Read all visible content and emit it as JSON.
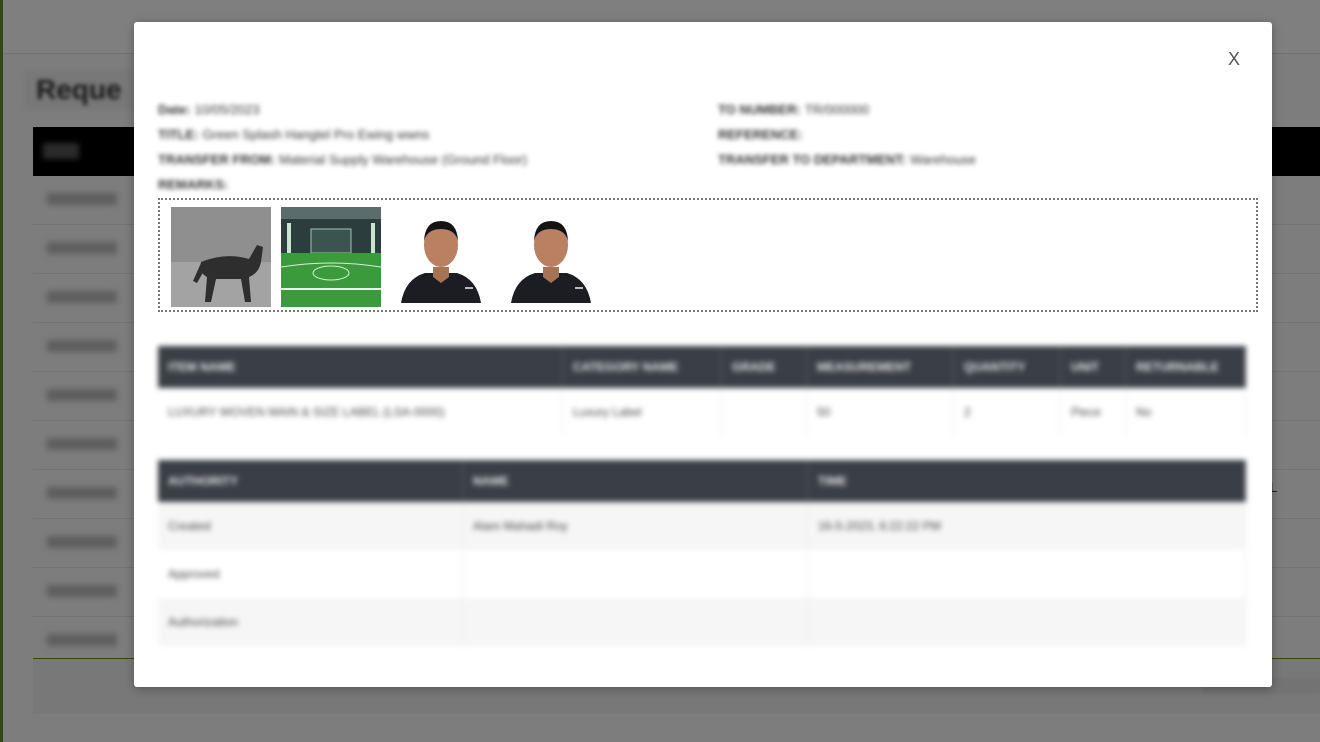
{
  "background": {
    "page_heading": "Reque",
    "table_rows": 10,
    "edge_char": "L"
  },
  "modal": {
    "close_label": "X",
    "info_left": [
      {
        "label": "Date:",
        "value": "10/05/2023"
      },
      {
        "label": "TITLE:",
        "value": "Green Splash Hangtel Pro Ewing wwns"
      },
      {
        "label": "TRANSFER FROM:",
        "value": "Material Supply Warehouse (Ground Floor)"
      },
      {
        "label": "REMARKS:",
        "value": ""
      }
    ],
    "info_right": [
      {
        "label": "TO NUMBER:",
        "value": "TR/000000"
      },
      {
        "label": "REFERENCE:",
        "value": ""
      },
      {
        "label": "TRANSFER TO DEPARTMENT:",
        "value": "Warehouse"
      }
    ],
    "attachments": [
      {
        "name": "dog-photo",
        "icon": "dog-photo"
      },
      {
        "name": "field-photo",
        "icon": "football-field-photo"
      },
      {
        "name": "portrait-photo-1",
        "icon": "person-portrait"
      },
      {
        "name": "portrait-photo-2",
        "icon": "person-portrait"
      }
    ],
    "items_table": {
      "headers": [
        "ITEM NAME",
        "CATEGORY NAME",
        "GRADE",
        "MEASUREMENT",
        "QUANTITY",
        "UNIT",
        "RETURNABLE"
      ],
      "rows": [
        [
          "LUXURY WOVEN MAIN & SIZE LABEL (LSA-0000)",
          "Luxury Label",
          "",
          "50",
          "2",
          "Piece",
          "No"
        ]
      ]
    },
    "authority_table": {
      "headers": [
        "AUTHORITY",
        "NAME",
        "TIME"
      ],
      "rows": [
        [
          "Created",
          "Alam Mahadi Roy",
          "16-5-2023, 6:22:22 PM"
        ],
        [
          "Approved",
          "",
          ""
        ],
        [
          "Authorization",
          "",
          ""
        ]
      ]
    }
  },
  "colors": {
    "overlay": "#000000",
    "table_header": "#3a3f47",
    "accent": "#6b8e23"
  }
}
